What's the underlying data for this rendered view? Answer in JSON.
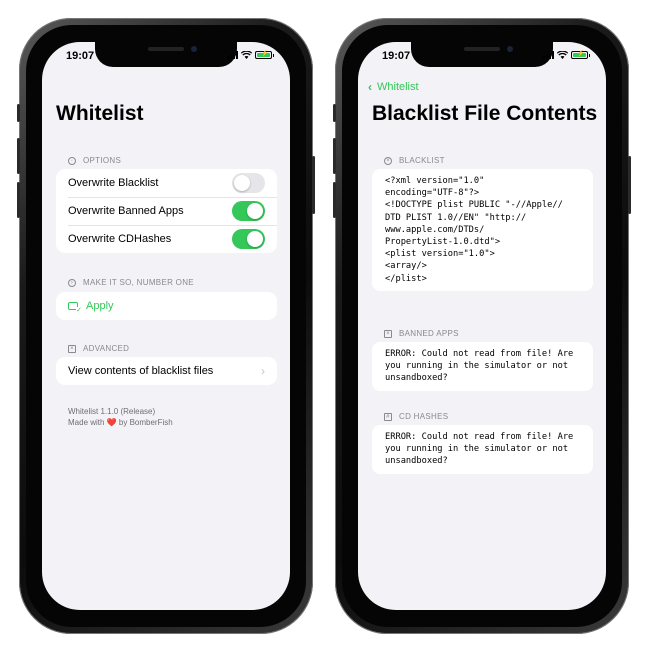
{
  "colors": {
    "accent": "#34c759",
    "background": "#f2f2f7",
    "secondary_text": "#8a8a8e"
  },
  "left_screen": {
    "status_time": "19:07",
    "title": "Whitelist",
    "options_header": "OPTIONS",
    "options_icon": "gear-icon",
    "options": [
      {
        "label": "Overwrite Blacklist",
        "enabled": false
      },
      {
        "label": "Overwrite Banned Apps",
        "enabled": true
      },
      {
        "label": "Overwrite CDHashes",
        "enabled": true
      }
    ],
    "make_it_so_header": "MAKE IT SO, NUMBER ONE",
    "apply_label": "Apply",
    "advanced_header": "ADVANCED",
    "view_contents_label": "View contents of blacklist files",
    "footer_version": "Whitelist 1.1.0 (Release)",
    "footer_made_with": "Made with",
    "footer_heart": "❤️",
    "footer_by": "by BomberFish"
  },
  "right_screen": {
    "status_time": "19:07",
    "back_label": "Whitelist",
    "title": "Blacklist File Contents",
    "blacklist_header": "BLACKLIST",
    "blacklist_content": "<?xml version=\"1.0\"\nencoding=\"UTF-8\"?>\n<!DOCTYPE plist PUBLIC \"-//Apple//\nDTD PLIST 1.0//EN\" \"http://\nwww.apple.com/DTDs/\nPropertyList-1.0.dtd\">\n<plist version=\"1.0\">\n<array/>\n</plist>",
    "banned_apps_header": "BANNED APPS",
    "banned_apps_content": "ERROR: Could not read from file! Are\nyou running in the simulator or not\nunsandboxed?",
    "cd_hashes_header": "CD HASHES",
    "cd_hashes_content": "ERROR: Could not read from file! Are\nyou running in the simulator or not\nunsandboxed?"
  }
}
